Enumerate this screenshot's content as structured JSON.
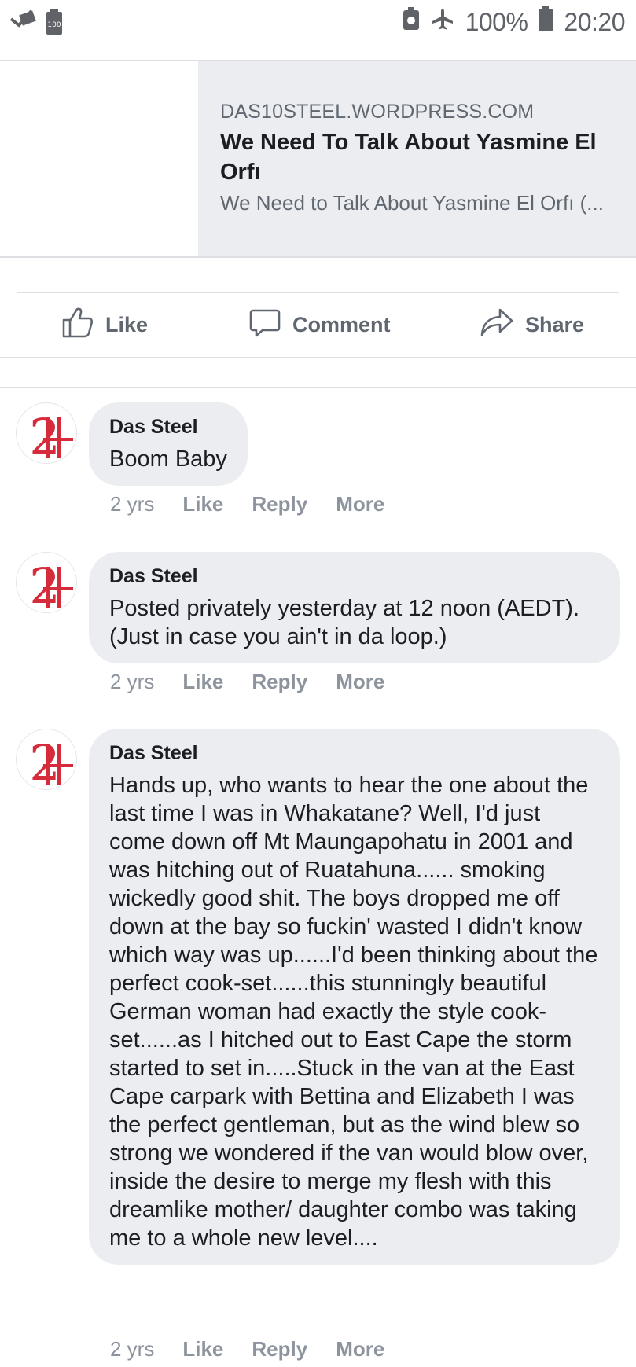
{
  "status_bar": {
    "battery_percent": "100%",
    "time": "20:20",
    "left_icons": [
      "mail-sync-icon",
      "battery-saver-icon"
    ],
    "right_icons": [
      "vault-icon",
      "airplane-mode-icon",
      "battery-icon"
    ],
    "small_badge": "100"
  },
  "link_preview": {
    "domain": "DAS10STEEL.WORDPRESS.COM",
    "title": "We Need To Talk About Yasmine El Orfı",
    "description": "We Need to Talk About Yasmine El Orfı (..."
  },
  "actions": {
    "like": "Like",
    "comment": "Comment",
    "share": "Share"
  },
  "comments": [
    {
      "author": "Das Steel",
      "text": "Boom Baby",
      "time": "2 yrs",
      "like": "Like",
      "reply": "Reply",
      "more": "More"
    },
    {
      "author": "Das Steel",
      "text": "Posted privately yesterday at 12 noon (AEDT). (Just in case you ain't in da loop.)",
      "time": "2 yrs",
      "like": "Like",
      "reply": "Reply",
      "more": "More"
    },
    {
      "author": "Das Steel",
      "text": "Hands up, who wants to hear the one about the last time I was in Whakatane? Well, I'd just come down off Mt Maungapohatu in 2001 and was hitching out of Ruatahuna...... smoking wickedly good shit. The boys dropped me off down at the bay so fuckin' wasted I didn't know which way was up......I'd been thinking about the perfect cook-set......this stunningly beautiful German woman had exactly the style cook-set......as I hitched out to East Cape the storm started to set in.....Stuck in the van at the East Cape carpark with Bettina and Elizabeth I was the perfect gentleman, but as the wind blew so strong we wondered if the van would blow over, inside the desire to merge my flesh with this dreamlike mother/ daughter combo was taking me to a whole new level....",
      "time": "2 yrs",
      "like": "Like",
      "reply": "Reply",
      "more": "More"
    }
  ],
  "colors": {
    "bubble": "#ebedf0",
    "link_bg": "#ebedf0",
    "meta_text": "#8d949e",
    "avatar_red": "#d62b3a"
  }
}
